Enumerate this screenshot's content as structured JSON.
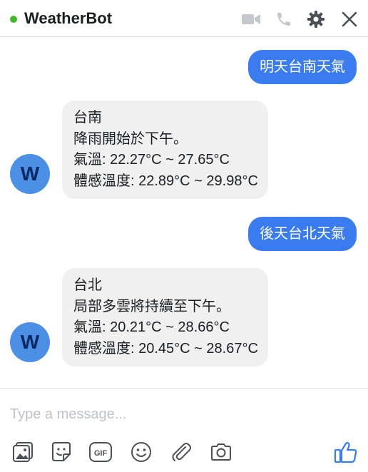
{
  "header": {
    "title": "WeatherBot",
    "status_color": "#42b72a"
  },
  "messages": [
    {
      "type": "outgoing",
      "text": "明天台南天氣"
    },
    {
      "type": "incoming",
      "avatar": "W",
      "lines": [
        "台南",
        "降雨開始於下午。",
        "氣溫: 22.27°C ~ 27.65°C",
        "體感溫度: 22.89°C ~ 29.98°C"
      ]
    },
    {
      "type": "outgoing",
      "text": "後天台北天氣"
    },
    {
      "type": "incoming",
      "avatar": "W",
      "lines": [
        "台北",
        "局部多雲將持續至下午。",
        "氣溫: 20.21°C ~ 28.66°C",
        "體感溫度: 20.45°C ~ 28.67°C"
      ]
    }
  ],
  "composer": {
    "placeholder": "Type a message...",
    "gif_label": "GIF"
  },
  "icons": {
    "header": [
      "video-call-icon",
      "phone-icon",
      "gear-icon",
      "close-icon"
    ],
    "toolbar": [
      "image-icon",
      "sticker-icon",
      "gif-icon",
      "emoji-icon",
      "attachment-icon",
      "camera-icon",
      "like-icon"
    ]
  },
  "colors": {
    "accent": "#3a7cf0",
    "bot_bubble": "#f0f0f0",
    "avatar": "#4c90e6"
  }
}
